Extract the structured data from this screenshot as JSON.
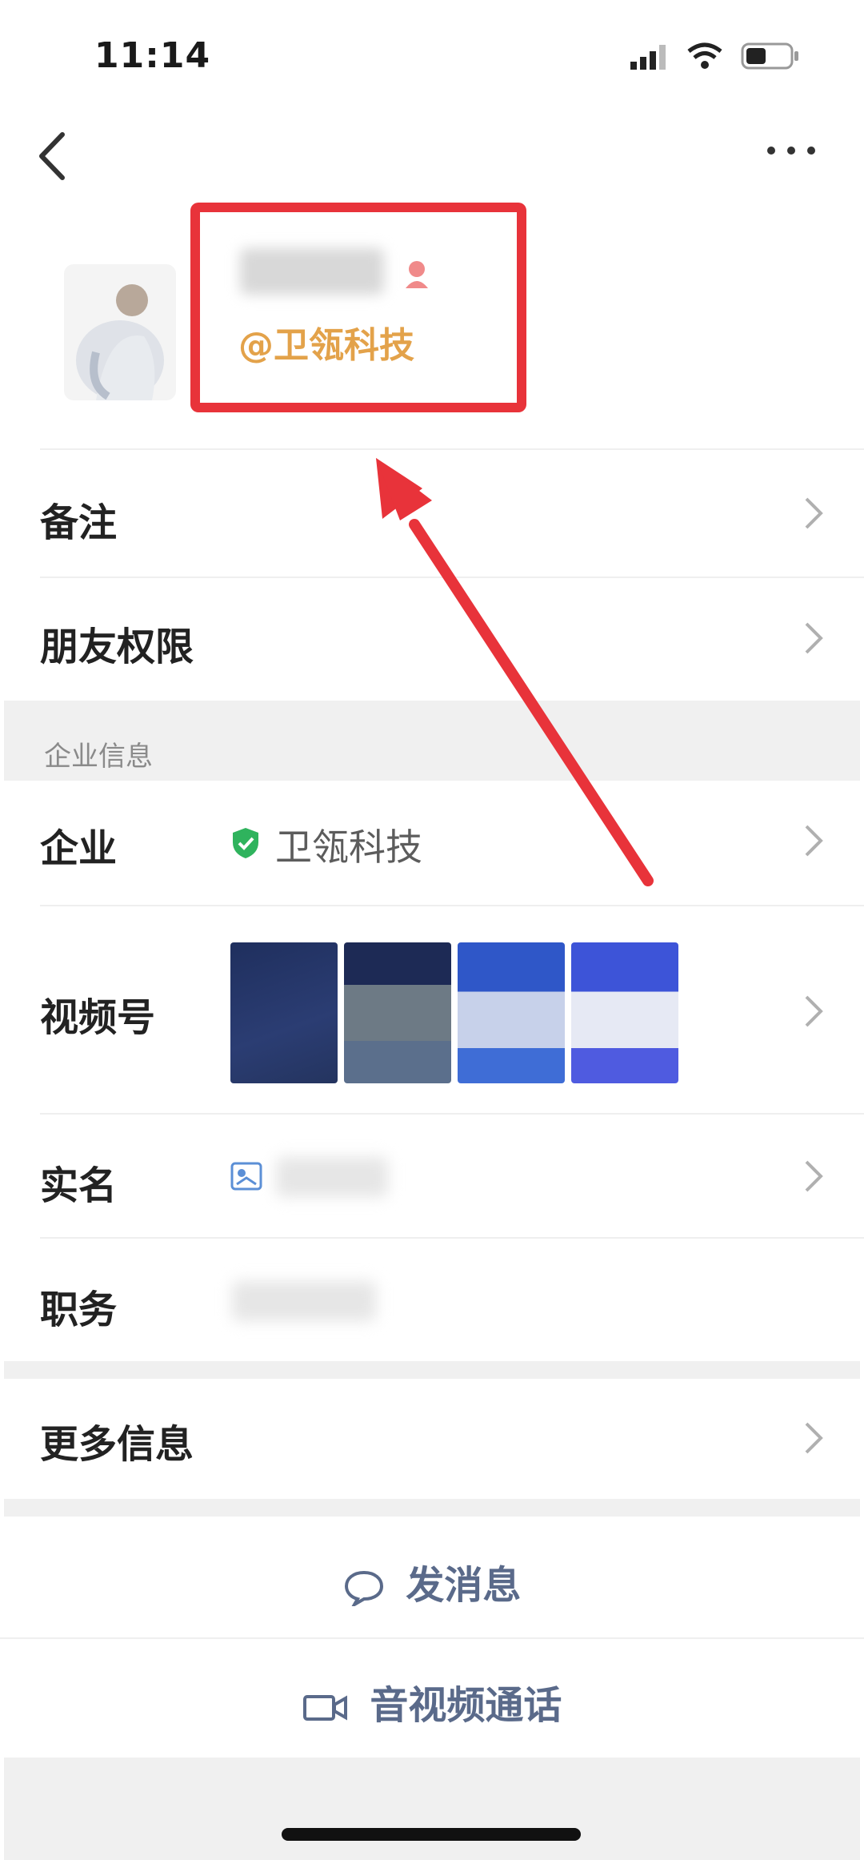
{
  "status_bar": {
    "time": "11:14"
  },
  "profile": {
    "corp_tag": "@卫瓴科技"
  },
  "rows": {
    "remark": {
      "label": "备注"
    },
    "friend_permission": {
      "label": "朋友权限"
    },
    "section_title": "企业信息",
    "enterprise": {
      "label": "企业",
      "value": "卫瓴科技"
    },
    "channels": {
      "label": "视频号"
    },
    "real_name": {
      "label": "实名"
    },
    "position": {
      "label": "职务"
    },
    "more_info": {
      "label": "更多信息"
    }
  },
  "actions": {
    "send_message": "发消息",
    "av_call": "音视频通话"
  },
  "colors": {
    "highlight": "#e8333a",
    "corp_tag": "#e3a24a",
    "verified": "#2fb35d",
    "action_text": "#5a6a8a"
  },
  "icons": [
    "back-icon",
    "more-icon",
    "signal-icon",
    "wifi-icon",
    "battery-icon",
    "gender-icon",
    "verified-shield-icon",
    "realname-card-icon",
    "chat-bubble-icon",
    "video-camera-icon",
    "chevron-right-icon"
  ]
}
